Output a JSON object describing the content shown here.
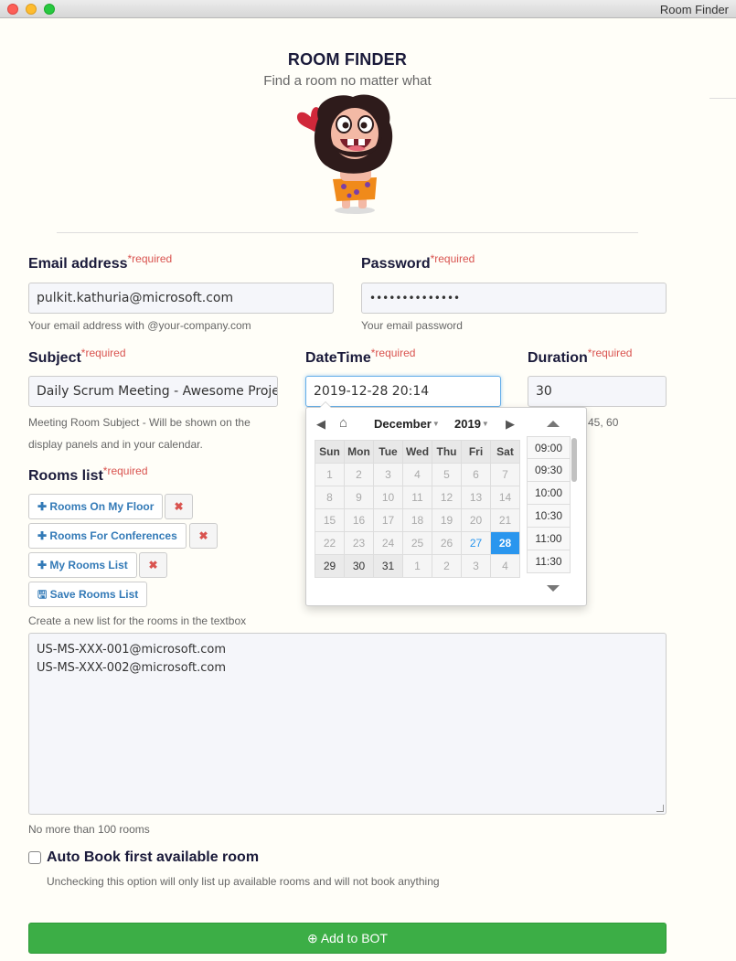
{
  "window": {
    "title": "Room Finder"
  },
  "header": {
    "title": "ROOM FINDER",
    "subtitle": "Find a room no matter what"
  },
  "required_mark": "*required",
  "email": {
    "label": "Email address",
    "value": "pulkit.kathuria@microsoft.com",
    "help": "Your email address with @your-company.com"
  },
  "password": {
    "label": "Password",
    "value": "••••••••••••••",
    "help": "Your email password"
  },
  "subject": {
    "label": "Subject",
    "value": "Daily Scrum Meeting - Awesome Project",
    "help_line1": "Meeting Room Subject - Will be shown on the",
    "help_line2": "display panels and in your calendar."
  },
  "datetime": {
    "label": "DateTime",
    "value": "2019-12-28 20:14"
  },
  "duration": {
    "label": "Duration",
    "value": "30",
    "help_partial": "45, 60"
  },
  "rooms": {
    "label": "Rooms list",
    "lists": [
      {
        "name": "Rooms On My Floor"
      },
      {
        "name": "Rooms For Conferences"
      },
      {
        "name": "My Rooms List"
      }
    ],
    "save_label": "Save Rooms List",
    "create_help": "Create a new list for the rooms in the textbox",
    "textarea_lines": [
      "US-MS-XXX-001@microsoft.com",
      "US-MS-XXX-002@microsoft.com"
    ],
    "limit_help": "No more than 100 rooms"
  },
  "autobook": {
    "label": "Auto Book first available room",
    "help": "Unchecking this option will only list up available rooms and will not book anything",
    "checked": false
  },
  "submit": {
    "label": "Add to BOT"
  },
  "picker": {
    "month": "December",
    "year": "2019",
    "weekdays": [
      "Sun",
      "Mon",
      "Tue",
      "Wed",
      "Thu",
      "Fri",
      "Sat"
    ],
    "weeks": [
      [
        "1",
        "2",
        "3",
        "4",
        "5",
        "6",
        "7"
      ],
      [
        "8",
        "9",
        "10",
        "11",
        "12",
        "13",
        "14"
      ],
      [
        "15",
        "16",
        "17",
        "18",
        "19",
        "20",
        "21"
      ],
      [
        "22",
        "23",
        "24",
        "25",
        "26",
        "27",
        "28"
      ],
      [
        "29",
        "30",
        "31",
        "1",
        "2",
        "3",
        "4"
      ]
    ],
    "today": "27",
    "selected": "28",
    "times": [
      "09:00",
      "09:30",
      "10:00",
      "10:30",
      "11:00",
      "11:30"
    ],
    "colors": {
      "selected": "#2a96ee",
      "today": "#2a96ee"
    }
  },
  "colors": {
    "submit": "#3cae46",
    "required": "#d9534f",
    "link": "#337ab7"
  }
}
